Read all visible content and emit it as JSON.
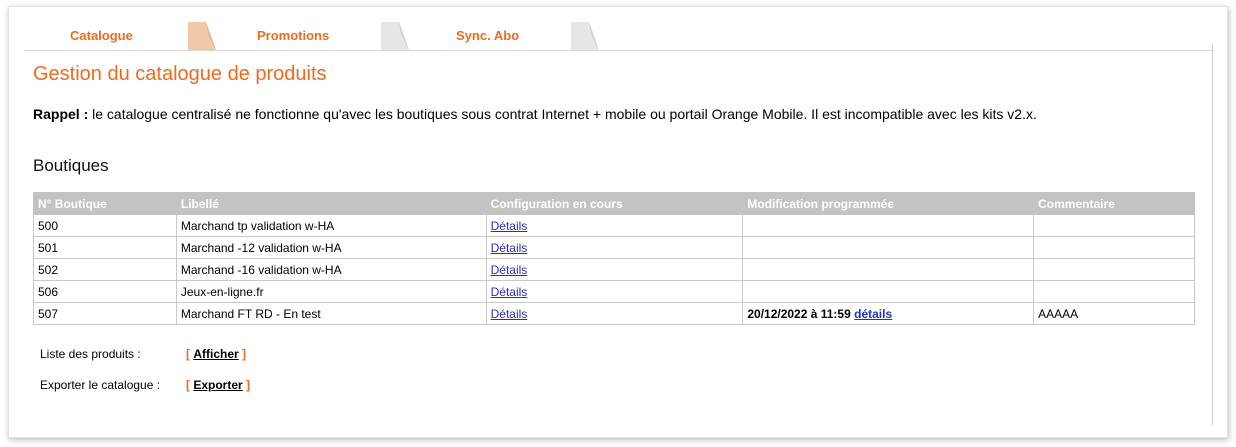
{
  "tabs": [
    {
      "label": "Catalogue"
    },
    {
      "label": "Promotions"
    },
    {
      "label": "Sync. Abo"
    }
  ],
  "page_title": "Gestion du catalogue de produits",
  "notice": {
    "strong": "Rappel :",
    "text": " le catalogue centralisé ne fonctionne qu'avec les boutiques sous contrat Internet + mobile ou portail Orange Mobile. Il est incompatible avec les kits v2.x."
  },
  "section_title": "Boutiques",
  "table": {
    "headers": [
      "N° Boutique",
      "Libellé",
      "Configuration en cours",
      "Modification programmée",
      "Commentaire"
    ],
    "rows": [
      {
        "id": "500",
        "label": "Marchand tp validation w-HA",
        "config": "Détails",
        "sched_date": "",
        "sched_link": "",
        "comment": ""
      },
      {
        "id": "501",
        "label": "Marchand -12 validation w-HA",
        "config": "Détails",
        "sched_date": "",
        "sched_link": "",
        "comment": ""
      },
      {
        "id": "502",
        "label": "Marchand -16 validation w-HA",
        "config": "Détails",
        "sched_date": "",
        "sched_link": "",
        "comment": ""
      },
      {
        "id": "506",
        "label": "Jeux-en-ligne.fr",
        "config": "Détails",
        "sched_date": "",
        "sched_link": "",
        "comment": ""
      },
      {
        "id": "507",
        "label": "Marchand FT RD - En test",
        "config": "Détails",
        "sched_date": "20/12/2022 à 11:59",
        "sched_link": "détails",
        "comment": "AAAAA"
      }
    ]
  },
  "actions": {
    "products_label": "Liste des produits :",
    "products_link": "Afficher",
    "export_label": "Exporter le catalogue :",
    "export_link": "Exporter",
    "bracket_open": "[",
    "bracket_close": "]"
  },
  "colors": {
    "accent": "#f06a1e",
    "header_bg": "#c3c3c3",
    "link": "#2b2bc8"
  }
}
